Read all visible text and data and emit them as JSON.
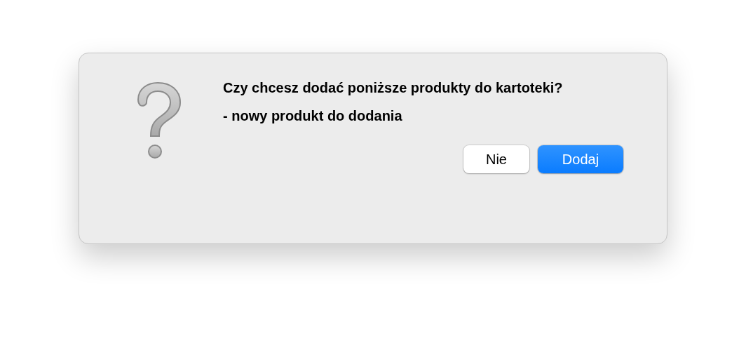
{
  "dialog": {
    "message": "Czy chcesz dodać poniższe produkty do kartoteki?",
    "detail": "- nowy produkt do dodania",
    "buttons": [
      {
        "label": "Nie",
        "kind": "secondary"
      },
      {
        "label": "Dodaj",
        "kind": "primary"
      }
    ]
  }
}
